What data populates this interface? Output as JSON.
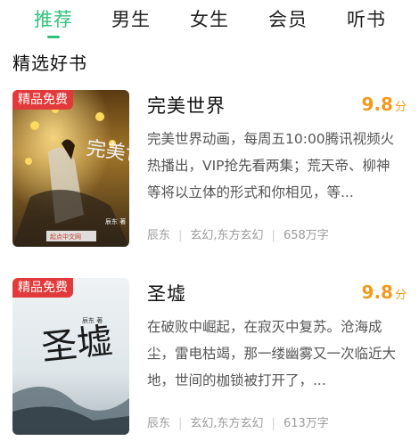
{
  "tabs": [
    "推荐",
    "男生",
    "女生",
    "会员",
    "听书"
  ],
  "section_title": "精选好书",
  "colors": {
    "accent": "#2fc27b",
    "score": "#f39a1e",
    "badge": "#e23a3a"
  },
  "books": [
    {
      "badge": "精品免费",
      "title": "完美世界",
      "score": "9.8",
      "score_unit": "分",
      "desc": "完美世界动画，每周五10:00腾讯视频火热播出，VIP抢先看两集；荒天帝、柳神等将以立体的形式和你相见，等...",
      "author": "辰东",
      "category": "玄幻,东方玄幻",
      "words": "658万字",
      "cover_text": "完美世界",
      "cover_author": "辰东 著",
      "cover_publisher": "起点中文网"
    },
    {
      "badge": "精品免费",
      "title": "圣墟",
      "score": "9.8",
      "score_unit": "分",
      "desc": "在破败中崛起，在寂灭中复苏。沧海成尘，雷电枯竭，那一缕幽雾又一次临近大地，世间的枷锁被打开了，...",
      "author": "辰东",
      "category": "玄幻,东方玄幻",
      "words": "613万字",
      "cover_text": "圣墟",
      "cover_author": "辰东 著"
    }
  ]
}
